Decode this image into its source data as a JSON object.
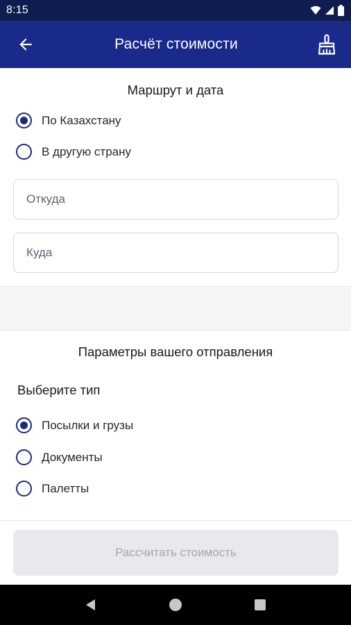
{
  "status_bar": {
    "time": "8:15"
  },
  "app_bar": {
    "title": "Расчёт стоимости"
  },
  "route": {
    "title": "Маршрут и дата",
    "options": [
      {
        "label": "По Казахстану",
        "checked": true
      },
      {
        "label": "В другую страну",
        "checked": false
      }
    ],
    "from_placeholder": "Откуда",
    "to_placeholder": "Куда"
  },
  "shipment": {
    "title": "Параметры вашего отправления",
    "type_heading": "Выберите тип",
    "options": [
      {
        "label": "Посылки и грузы",
        "checked": true
      },
      {
        "label": "Документы",
        "checked": false
      },
      {
        "label": "Палетты",
        "checked": false
      }
    ]
  },
  "actions": {
    "calculate_label": "Рассчитать стоимость"
  },
  "colors": {
    "status_bar": "#0f1c4f",
    "app_bar": "#192a8a",
    "accent": "#1a2a7a",
    "button_disabled": "#e8e9ec"
  }
}
